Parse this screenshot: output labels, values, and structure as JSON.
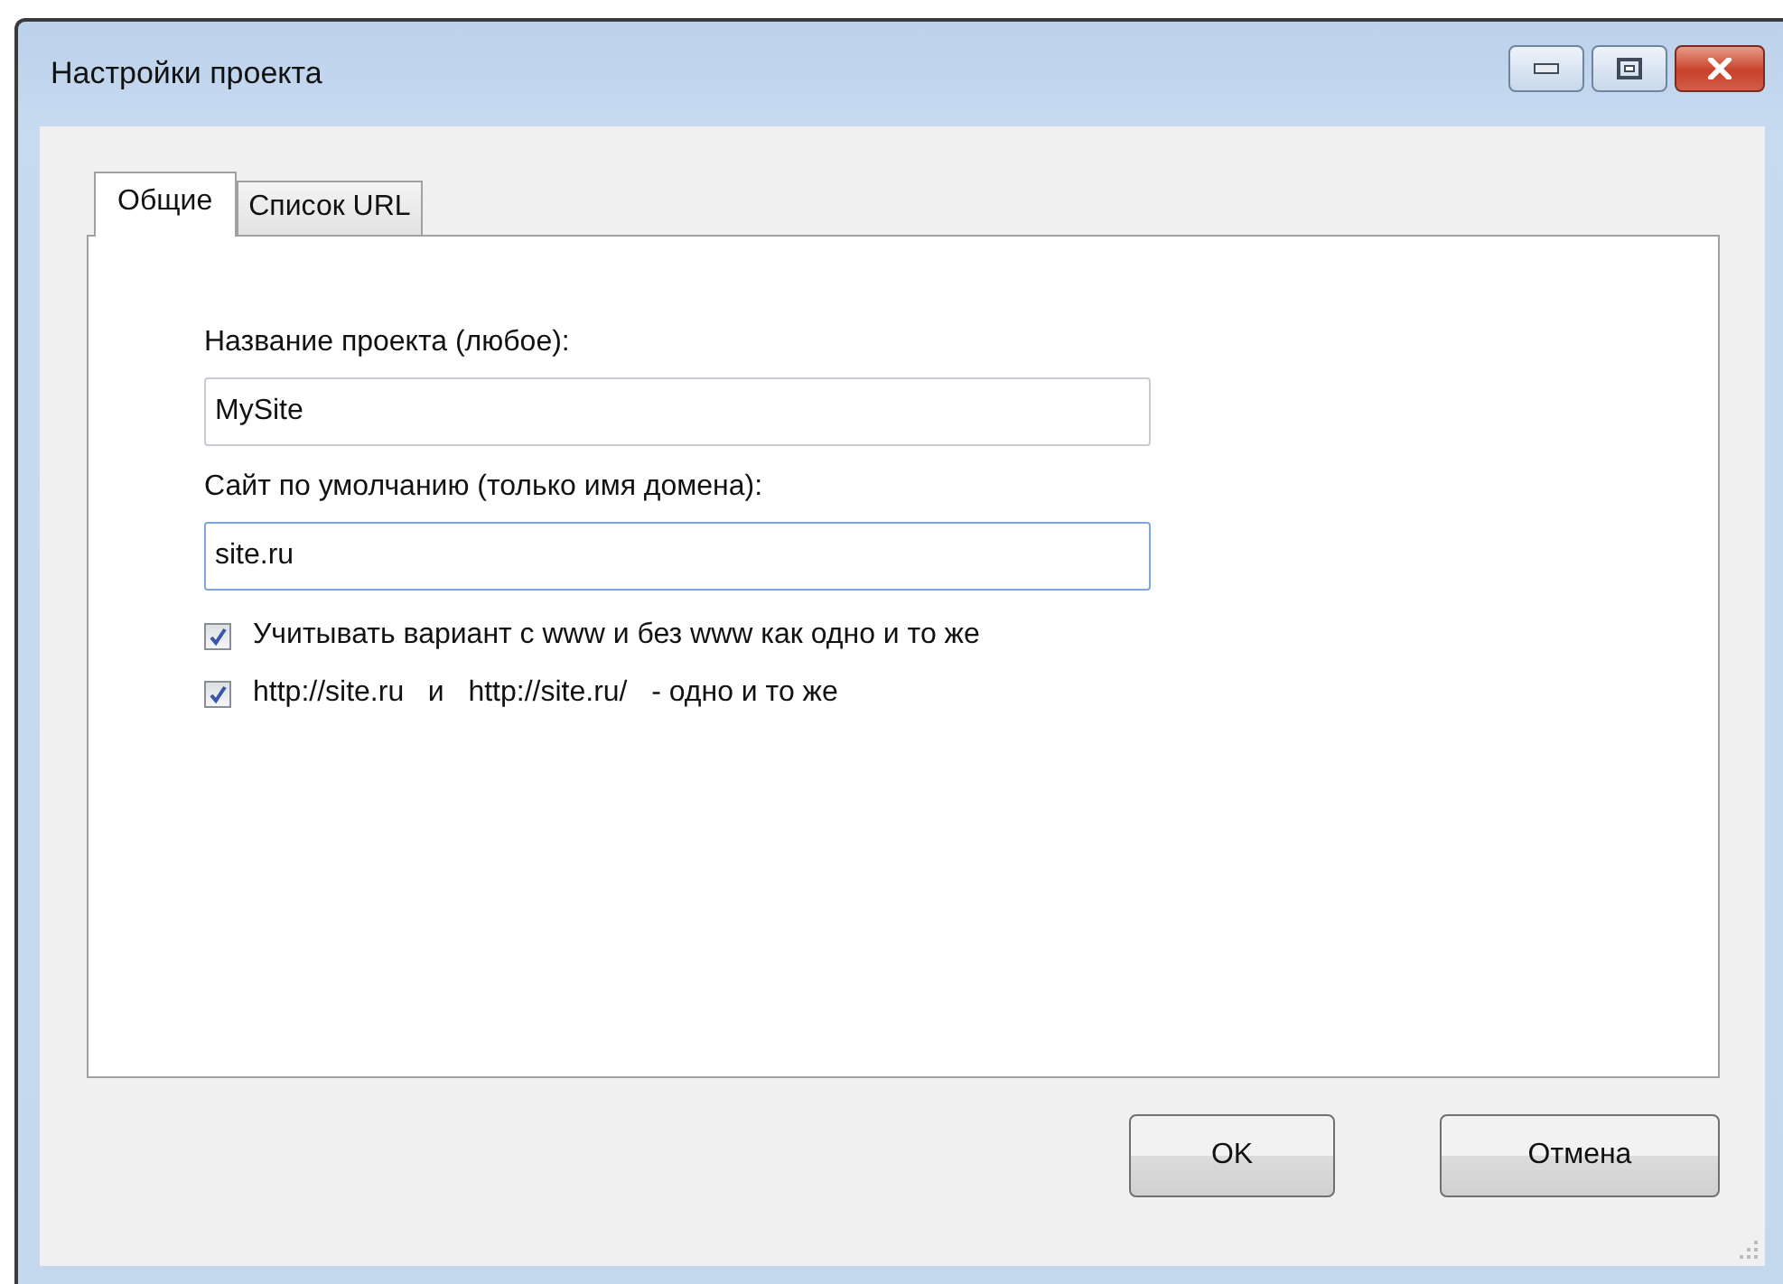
{
  "window": {
    "title": "Настройки проекта"
  },
  "title_buttons": [
    {
      "kind": "minimize"
    },
    {
      "kind": "maximize"
    },
    {
      "kind": "close"
    }
  ],
  "tabs": [
    {
      "label": "Общие",
      "selected": true
    },
    {
      "label": "Список URL",
      "selected": false
    }
  ],
  "fields": [
    {
      "label": "Название проекта (любое):",
      "value": "MySite",
      "focused": false
    },
    {
      "label": "Сайт по умолчанию (только имя домена):",
      "value": "site.ru",
      "focused": true
    }
  ],
  "checkboxes": [
    {
      "label": "Учитывать вариант с www и без www как одно и то же",
      "checked": true
    },
    {
      "label": "http://site.ru   и   http://site.ru/   - одно и то же",
      "checked": true
    }
  ],
  "buttons": [
    "OK",
    "Отмена"
  ]
}
